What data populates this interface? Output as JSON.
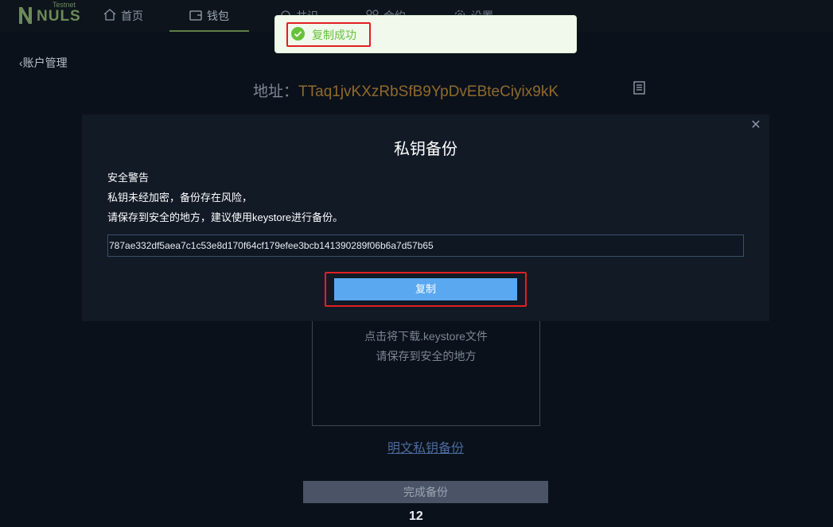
{
  "app": {
    "logo_text": "NULS",
    "logo_badge": "Testnet"
  },
  "nav": {
    "home": "首页",
    "wallet": "钱包",
    "node": "共识",
    "contract": "合约",
    "settings": "设置"
  },
  "toast": {
    "message": "复制成功",
    "status_color": "#67c23a"
  },
  "page": {
    "back_label": "账户管理",
    "address_label": "地址：",
    "address_value": "TTaq1jvKXzRbSfB9YpDvEBteCiyix9kK",
    "keystore_hint_1": "点击将下载.keystore文件",
    "keystore_hint_2": "请保存到安全的地方",
    "plain_backup_link": "明文私钥备份",
    "finish_button": "完成备份",
    "page_number": "12"
  },
  "dialog": {
    "title": "私钥备份",
    "warning_title": "安全警告",
    "warning_line_1": "私钥未经加密，备份存在风险，",
    "warning_line_2": "请保存到安全的地方，建议使用keystore进行备份。",
    "private_key": "787ae332df5aea7c1c53e8d170f64cf179efee3bcb141390289f06b6a7d57b65",
    "copy_button": "复制",
    "accent_color": "#5aa8f0"
  }
}
